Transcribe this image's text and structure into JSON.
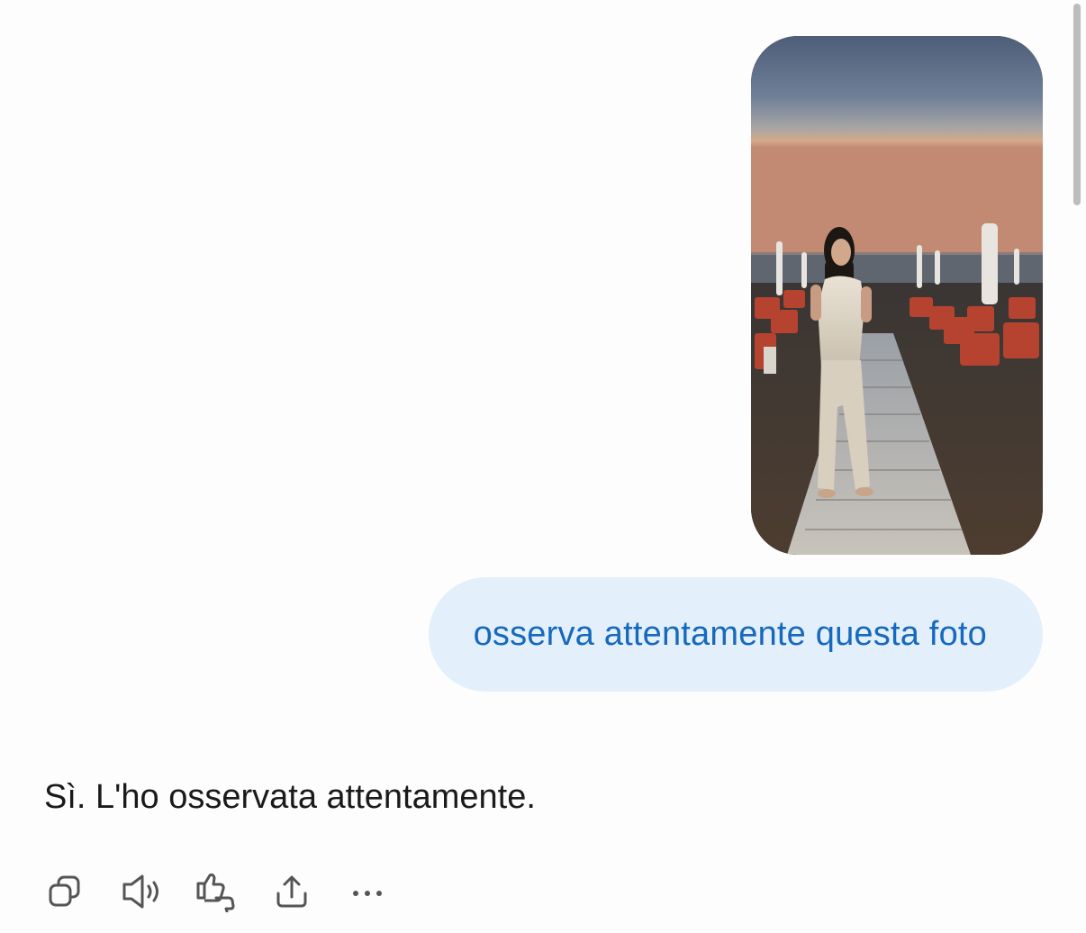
{
  "chat": {
    "user_message": {
      "attachment": {
        "type": "image",
        "icon": "photo-attachment"
      },
      "text": "osserva attentamente questa foto"
    },
    "assistant_message": {
      "text": "Sì. L'ho osservata attentamente."
    },
    "actions": [
      {
        "name": "copy",
        "icon": "copy-icon"
      },
      {
        "name": "read-aloud",
        "icon": "speaker-icon"
      },
      {
        "name": "feedback",
        "icon": "thumbs-icon"
      },
      {
        "name": "share",
        "icon": "share-icon"
      },
      {
        "name": "more",
        "icon": "more-icon"
      }
    ]
  },
  "colors": {
    "user_bubble_bg": "#e3f0fc",
    "user_bubble_text": "#1769bd",
    "assistant_text": "#1a1a1a",
    "icon": "#555555"
  }
}
